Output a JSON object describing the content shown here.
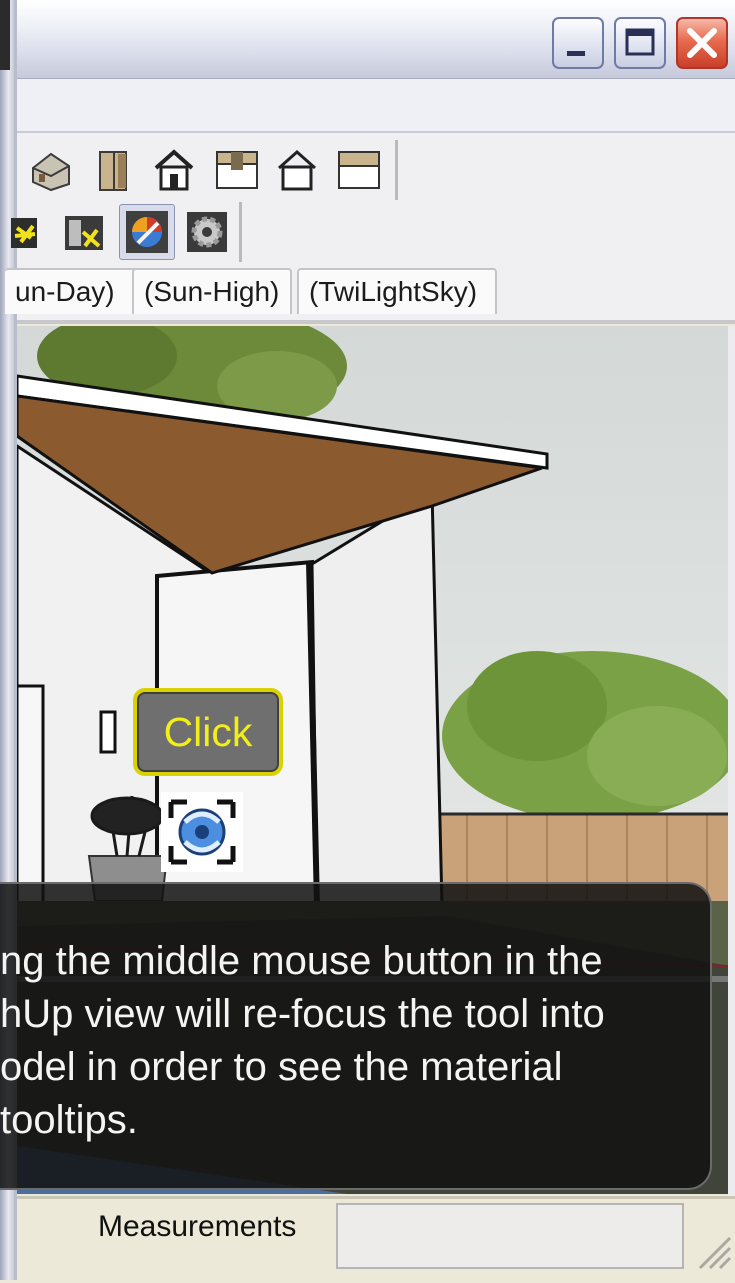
{
  "window": {
    "controls": [
      "minimize",
      "maximize",
      "close"
    ]
  },
  "toolbar_1": {
    "icons": [
      "iso-view-icon",
      "front-view-icon",
      "house-view-icon",
      "top-view-icon",
      "outline-house-icon",
      "side-view-icon"
    ]
  },
  "toolbar_2": {
    "icons": [
      "light-rays-icon",
      "sun-settings-icon",
      "material-palette-icon",
      "gear-icon"
    ],
    "pressed_index": 2
  },
  "tabs": [
    "un-Day)",
    "(Sun-High)",
    "(TwiLightSky)"
  ],
  "overlay": {
    "click_label": "Click",
    "tooltip_lines": [
      "ng the middle mouse button in the",
      "hUp view will re-focus the tool into",
      "odel in order to see the material",
      " tooltips."
    ]
  },
  "status": {
    "measurements_label": "Measurements",
    "measurements_value": ""
  },
  "colors": {
    "tooltip_bg": "#121212",
    "click_text": "#f2ee1a",
    "click_border": "#d9d200"
  }
}
